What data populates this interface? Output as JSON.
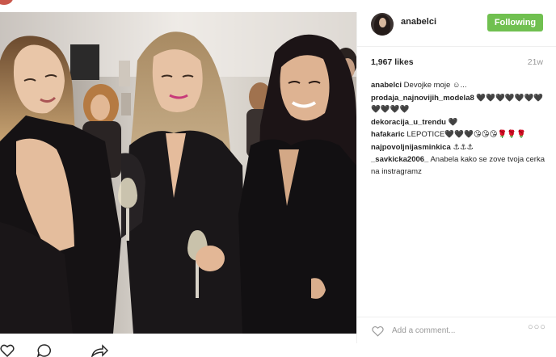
{
  "header": {
    "username": "anabelci",
    "follow_label": "Following"
  },
  "stats": {
    "likes": "1,967 likes",
    "time_ago": "21w"
  },
  "comments": [
    {
      "user": "anabelci",
      "text": "Devojke moje ☺..."
    },
    {
      "user": "prodaja_najnovijih_modela8",
      "text": "🖤🖤🖤🖤🖤🖤🖤🖤🖤🖤🖤"
    },
    {
      "user": "dekoracija_u_trendu",
      "text": "🖤"
    },
    {
      "user": "hafakaric",
      "text": "LEPOTICE🖤🖤🖤😘😘😘🌹🌹🌹"
    },
    {
      "user": "najpovoljnijasminkica",
      "text": "⚓⚓⚓"
    },
    {
      "user": "_savkicka2006_",
      "text": "Anabela kako se zove tvoja cerka na instragramz"
    }
  ],
  "add_comment": {
    "placeholder": "Add a comment..."
  },
  "colors": {
    "follow_green": "#70c050",
    "text": "#262626",
    "muted": "#999999"
  },
  "icons": [
    "heart-icon",
    "comment-icon",
    "share-icon",
    "more-options-icon"
  ]
}
